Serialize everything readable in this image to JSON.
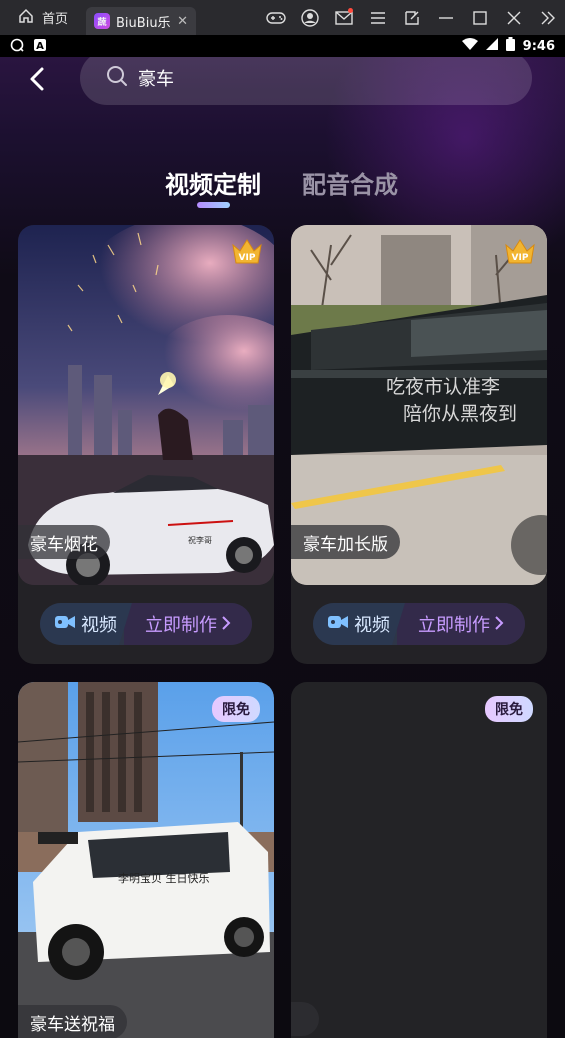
{
  "window": {
    "home_tab_label": "首页",
    "app_tab_label": "BiuBiu乐",
    "app_tab_badge": "蔬"
  },
  "status": {
    "time": "9:46"
  },
  "search": {
    "query": "豪车"
  },
  "tabs": [
    {
      "label": "视频定制",
      "active": true
    },
    {
      "label": "配音合成",
      "active": false
    }
  ],
  "cards": [
    {
      "title": "豪车烟花",
      "badge": "VIP",
      "action_type": "视频",
      "action_label": "立即制作"
    },
    {
      "title": "豪车加长版",
      "badge": "VIP",
      "action_type": "视频",
      "action_label": "立即制作"
    },
    {
      "title": "豪车送祝福",
      "badge": "限免"
    },
    {
      "title": "",
      "badge": "限免"
    }
  ],
  "overlay_text": {
    "car2_line1": "吃夜市认准李",
    "car2_line2": "陪你从黑夜到",
    "car1_plate": "祝李哥",
    "car3_door": "李明宝贝 生日快乐"
  },
  "colors": {
    "accent_purple": "#c79bff",
    "app_bg": "#0c0a10"
  }
}
